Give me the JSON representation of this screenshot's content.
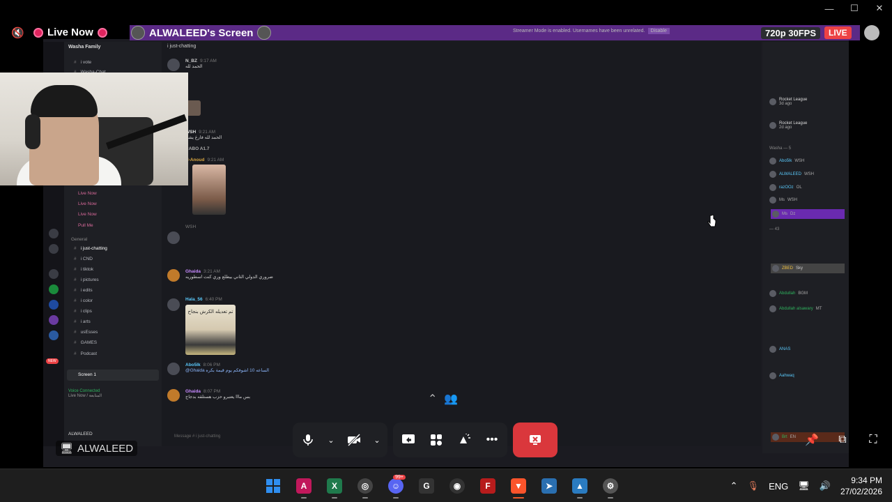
{
  "window": {
    "minimize": "—",
    "maximize": "☐",
    "close": "✕"
  },
  "stream_header": {
    "live_label": "Live Now",
    "screen_title": "ALWALEED's Screen",
    "streamer_mode_note": "Streamer Mode is enabled. Usernames have been unrelated.",
    "disable_label": "Disable",
    "quality": "720p 30FPS",
    "live_badge": "LIVE"
  },
  "discord": {
    "server_name": "Washa Family",
    "channel_header": "i just-chatting",
    "channels": [
      {
        "label": "i vote"
      },
      {
        "label": "Washa-Chat"
      }
    ],
    "live_entries": [
      "Live Now",
      "Live Now",
      "Live Now",
      "Pull Me"
    ],
    "category": "General",
    "text_channels": [
      {
        "label": "i just-chatting",
        "active": true
      },
      {
        "label": "i CND"
      },
      {
        "label": "i tiktok"
      },
      {
        "label": "i pictures"
      },
      {
        "label": "i edits"
      },
      {
        "label": "i color"
      },
      {
        "label": "i clips"
      },
      {
        "label": "i arts"
      },
      {
        "label": "usEsses"
      },
      {
        "label": "GAMES"
      },
      {
        "label": "Podcast"
      }
    ],
    "screen_pill": "Screen 1",
    "voice_connected": "Voice Connected",
    "voice_sub": "Live Now / المتابعة",
    "user_name": "ALWALEED",
    "new_badge": "NEW",
    "messages": [
      {
        "user": "N-Anoud",
        "tag": "N_BZ",
        "time": "9:17 AM",
        "text": "الحمد لله"
      },
      {
        "user": "CABO A1.7",
        "tag": "WSH",
        "time": "9:21 AM",
        "text": "الحمد لله فارغ يشم"
      },
      {
        "user": "N-Anoud",
        "tag": "N_BZ",
        "time": "9:21 AM",
        "text": ""
      },
      {
        "user": "Ghaida",
        "tag": "OL",
        "time": "3:21 AM",
        "text": "ضروري الدولي الثاني بيطلع وري كنت اسطوريه"
      },
      {
        "user": "Hala_56",
        "tag": "N_BZ",
        "time": "6:40 PM",
        "text": "تم تعديله الكرش بنجاح"
      },
      {
        "user": "Abo5lk",
        "tag": "WSH",
        "time": "8:06 PM",
        "text": "@Ghaida الساعه 10 اشوفكم يوم قيمة بكره"
      },
      {
        "user": "Ghaida",
        "tag": "OL",
        "time": "8:07 PM",
        "text": "بس مااا يعتبرو حزب هستلقه بدجاج"
      }
    ],
    "input_placeholder": "Message # i just-chatting",
    "members": [
      {
        "name": "Rocket League",
        "sub": "3d ago"
      },
      {
        "name": "Rocket League",
        "sub": "2d ago"
      },
      {
        "name": "Washa — 5",
        "sub": ""
      },
      {
        "name": "Abo5lk",
        "sub": "WSH"
      },
      {
        "name": "ALWALEED",
        "sub": "WSH"
      },
      {
        "name": "razOOz",
        "sub": "OL"
      },
      {
        "name": "Ms",
        "sub": "WSH"
      },
      {
        "name": "Ms",
        "sub": "Dz"
      },
      {
        "name": "— 43",
        "sub": ""
      },
      {
        "name": "ZBED",
        "sub": "Sky"
      },
      {
        "name": "Abdullah",
        "sub": "BGM"
      },
      {
        "name": "Abdullah alsawary",
        "sub": "MT"
      },
      {
        "name": "ANAS",
        "sub": ""
      },
      {
        "name": "Aahwaq",
        "sub": ""
      },
      {
        "name": "Brt",
        "sub": "EN"
      }
    ]
  },
  "presenter": {
    "name": "ALWALEED"
  },
  "call_controls": {
    "mic": "mic-icon",
    "camera_off": "camera-off-icon",
    "share": "share-screen-icon",
    "activities": "activities-icon",
    "soundboard": "soundboard-icon",
    "more": "•••",
    "end": "end-stream-icon"
  },
  "taskbar": {
    "apps": [
      {
        "name": "start",
        "color": "#2f8ef0"
      },
      {
        "name": "affinity",
        "color": "#c1185b"
      },
      {
        "name": "excel-like",
        "color": "#1f7a4c"
      },
      {
        "name": "obs",
        "color": "#444"
      },
      {
        "name": "discord",
        "color": "#5865f2",
        "badge": "99+"
      },
      {
        "name": "g-hub",
        "color": "#333"
      },
      {
        "name": "davinci",
        "color": "#333"
      },
      {
        "name": "fl-studio",
        "color": "#b71c1c"
      },
      {
        "name": "brave",
        "color": "#fb542b",
        "active": true
      },
      {
        "name": "paper-plane",
        "color": "#2a6fb0"
      },
      {
        "name": "photos",
        "color": "#2a7bc0"
      },
      {
        "name": "settings",
        "color": "#555"
      }
    ],
    "language": "ENG",
    "time": "9:34 PM",
    "date": "27/02/2026"
  },
  "colors": {
    "live_red": "#ed4245",
    "purple_bar": "#5b2a86",
    "end_red": "#da373c"
  }
}
